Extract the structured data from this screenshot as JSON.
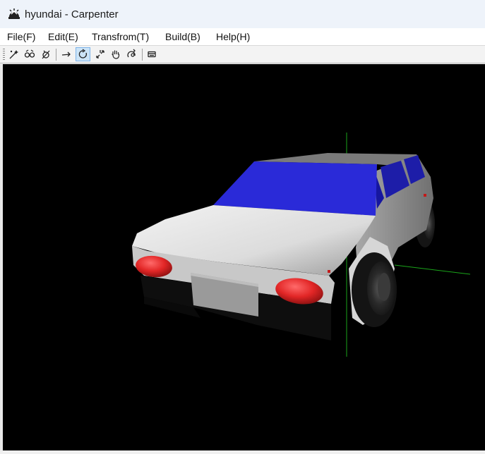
{
  "window": {
    "title": "hyundai - Carpenter"
  },
  "menu": [
    {
      "id": "file",
      "label": "File(F)"
    },
    {
      "id": "edit",
      "label": "Edit(E)"
    },
    {
      "id": "transform",
      "label": "Transfrom(T)"
    },
    {
      "id": "build",
      "label": "Build(B)"
    },
    {
      "id": "help",
      "label": "Help(H)"
    }
  ],
  "toolbar": {
    "tools": [
      {
        "icon": "magic-select-icon",
        "active": false
      },
      {
        "icon": "link-objects-icon",
        "active": false
      },
      {
        "icon": "unlink-objects-icon",
        "active": false
      },
      {
        "icon": "move-arrow-icon",
        "active": false
      },
      {
        "icon": "rotate-icon",
        "active": true
      },
      {
        "icon": "scale-icon",
        "active": false
      },
      {
        "icon": "pan-hand-icon",
        "active": false
      },
      {
        "icon": "orbit-view-icon",
        "active": false
      },
      {
        "icon": "render-window-icon",
        "active": false
      }
    ]
  },
  "viewport": {
    "background": "#000000",
    "scene": "3D car model",
    "colors": {
      "body": "#d0d0d0",
      "windows": "#2a2ad8",
      "lights": "#e02a2a",
      "axis_green": "#1aa51a",
      "tires": "#1c1c1c"
    }
  }
}
